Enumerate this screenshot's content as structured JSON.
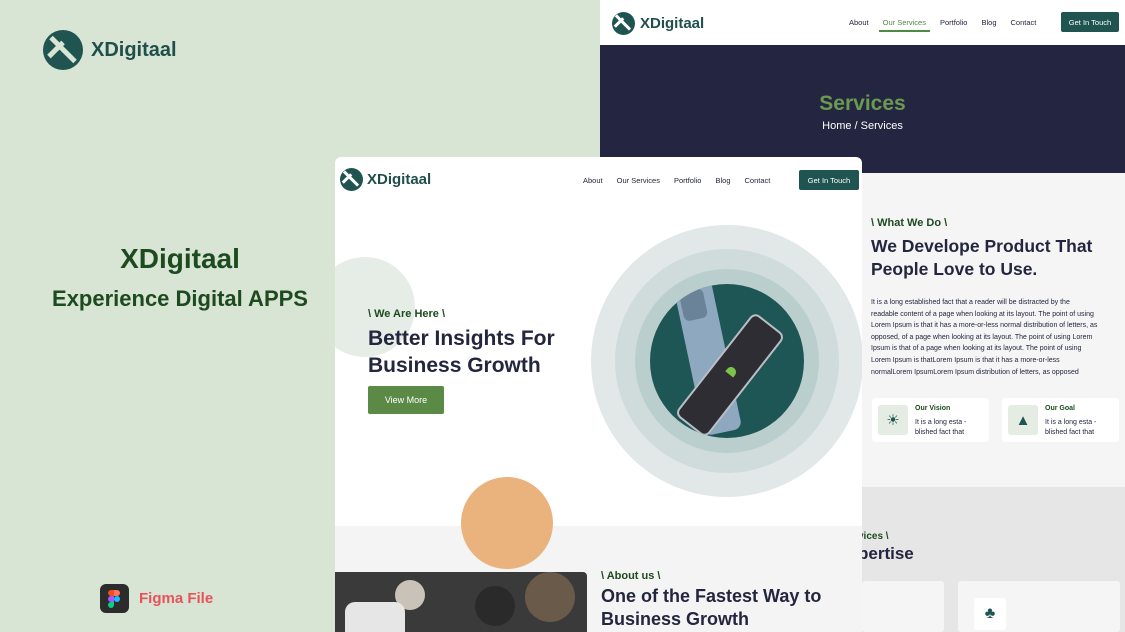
{
  "brand": {
    "name": "XDigitaal",
    "tagline_title": "XDigitaal",
    "tagline_sub": "Experience Digital APPS",
    "figma_label": "Figma File"
  },
  "nav": {
    "logo": "XDigitaal",
    "links": [
      "About",
      "Our Services",
      "Portfolio",
      "Blog",
      "Contact"
    ],
    "cta": "Get In Touch"
  },
  "services_page": {
    "banner_title": "Services",
    "breadcrumb": "Home / Services",
    "what_eyebrow": "\\ What We Do \\",
    "what_title": "We Develope Product That People Love to Use.",
    "what_body": "It is a long established fact that a reader will be distracted by the readable content of a page when looking at its layout. The point of using Lorem Ipsum is that it has a more-or-less normal distribution of letters, as opposed,  of a page when looking at its layout. The point of using Lorem Ipsum is that of a page when looking at its layout. The point of using Lorem Ipsum is thatLorem Ipsum is that it has a more-or-less normalLorem IpsumLorem Ipsum distribution of letters, as opposed",
    "cards": [
      {
        "title": "Our Vision",
        "text": "It is a long esta -blished fact that",
        "icon": "lightbulb-icon"
      },
      {
        "title": "Our Goal",
        "text": "It is a long esta -blished fact that",
        "icon": "podium-icon"
      }
    ],
    "expertise_eyebrow": "vices \\",
    "expertise_title": "pertise",
    "tile_icon": "tree-icon"
  },
  "home_page": {
    "eyebrow": "\\ We Are Here \\",
    "hero_title": "Better Insights For Business Growth",
    "button": "View More",
    "about_eyebrow": "\\ About us \\",
    "about_title": "One of the Fastest Way to Business Growth"
  },
  "colors": {
    "accent_green": "#5b8a47",
    "dark_teal": "#1f5450",
    "navy": "#242641",
    "peach": "#e8ac72"
  }
}
